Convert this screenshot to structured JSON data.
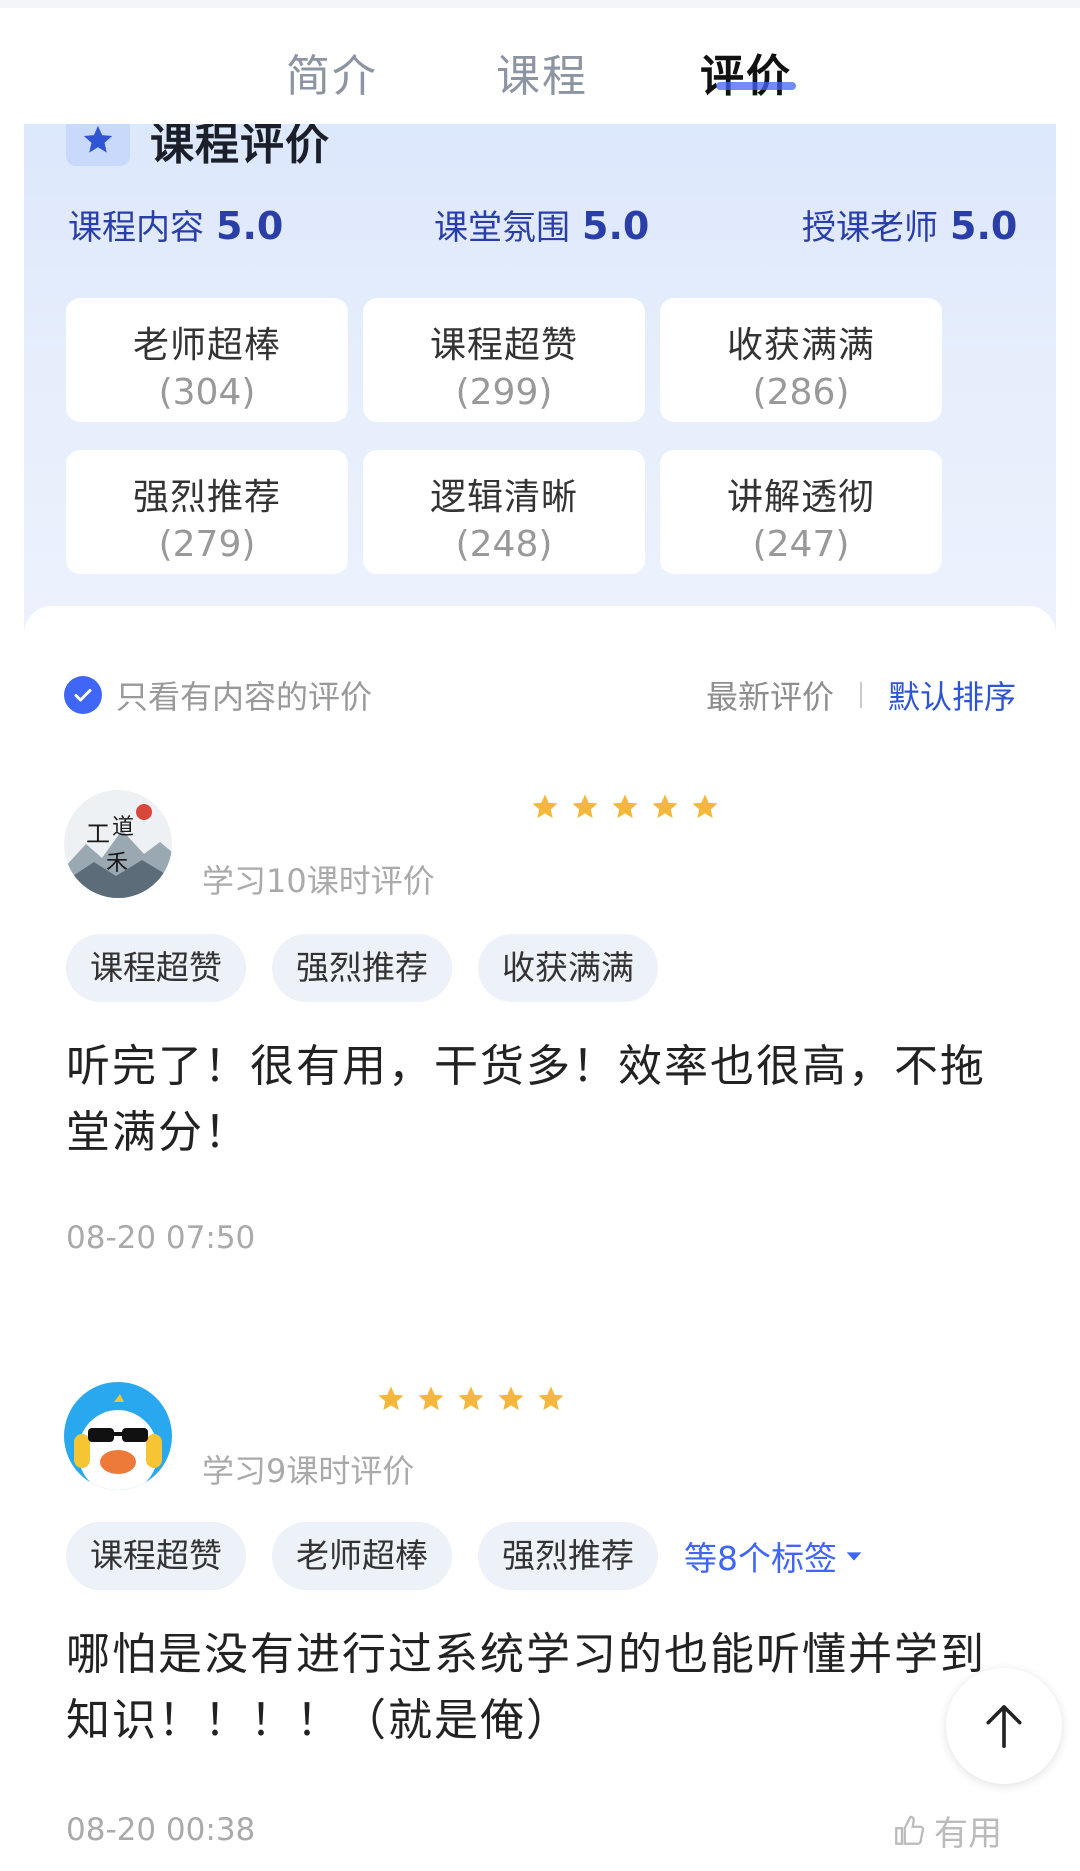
{
  "tabs": [
    {
      "label": "简介"
    },
    {
      "label": "课程"
    },
    {
      "label": "评价"
    }
  ],
  "summary": {
    "title": "课程评价",
    "scores": [
      {
        "label": "课程内容",
        "value": "5.0"
      },
      {
        "label": "课堂氛围",
        "value": "5.0"
      },
      {
        "label": "授课老师",
        "value": "5.0"
      }
    ],
    "tags": [
      {
        "label": "老师超棒",
        "count": "(304)"
      },
      {
        "label": "课程超赞",
        "count": "(299)"
      },
      {
        "label": "收获满满",
        "count": "(286)"
      },
      {
        "label": "强烈推荐",
        "count": "(279)"
      },
      {
        "label": "逻辑清晰",
        "count": "(248)"
      },
      {
        "label": "讲解透彻",
        "count": "(247)"
      }
    ]
  },
  "filters": {
    "content_only_label": "只看有内容的评价",
    "sort_latest": "最新评价",
    "sort_default": "默认排序"
  },
  "reviews": [
    {
      "rating": 5,
      "meta": "学习10课时评价",
      "tags": [
        "课程超赞",
        "强烈推荐",
        "收获满满"
      ],
      "text": "听完了！很有用，干货多！效率也很高，不拖堂满分！",
      "date": "08-20 07:50"
    },
    {
      "rating": 5,
      "meta": "学习9课时评价",
      "tags": [
        "课程超赞",
        "老师超棒",
        "强烈推荐"
      ],
      "more_tags": "等8个标签",
      "text": "哪怕是没有进行过系统学习的也能听懂并学到知识！！！！（就是俺）",
      "date": "08-20 00:38",
      "useful_label": "有用"
    }
  ],
  "colors": {
    "accent": "#3f66f5",
    "star": "#f5b73b",
    "score_text": "#2a3ea8"
  }
}
